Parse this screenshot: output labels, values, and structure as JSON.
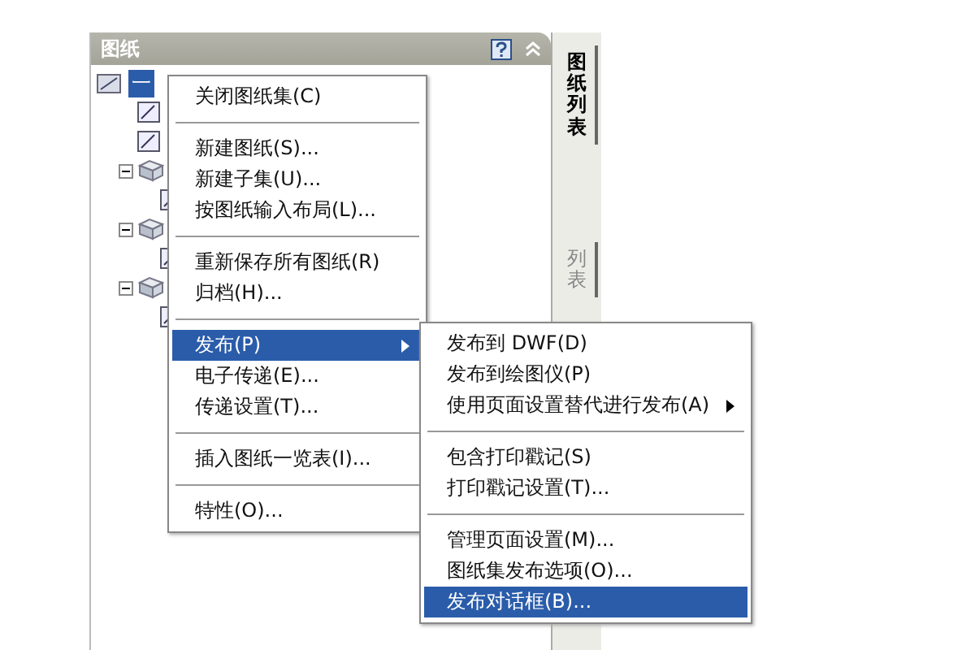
{
  "panel": {
    "title": "图纸"
  },
  "side_tabs": [
    {
      "label": "图纸列表",
      "selected": true
    },
    {
      "label": "列表",
      "selected": false
    }
  ],
  "tree": [
    {
      "kind": "set",
      "label": "一",
      "selected": true,
      "children": [
        {
          "kind": "sheet"
        },
        {
          "kind": "sheet"
        },
        {
          "kind": "subset",
          "expanded": true,
          "children": [
            {
              "kind": "sheet"
            }
          ]
        },
        {
          "kind": "subset",
          "expanded": true,
          "children": [
            {
              "kind": "sheet"
            }
          ]
        },
        {
          "kind": "subset",
          "expanded": true,
          "children": [
            {
              "kind": "sheet"
            }
          ]
        }
      ]
    }
  ],
  "context_menu": [
    {
      "kind": "item",
      "label": "关闭图纸集(C)",
      "selected": false,
      "submenu": false
    },
    {
      "kind": "separator"
    },
    {
      "kind": "item",
      "label": "新建图纸(S)...",
      "selected": false,
      "submenu": false
    },
    {
      "kind": "item",
      "label": "新建子集(U)...",
      "selected": false,
      "submenu": false
    },
    {
      "kind": "item",
      "label": "按图纸输入布局(L)...",
      "selected": false,
      "submenu": false
    },
    {
      "kind": "separator"
    },
    {
      "kind": "item",
      "label": "重新保存所有图纸(R)",
      "selected": false,
      "submenu": false
    },
    {
      "kind": "item",
      "label": "归档(H)...",
      "selected": false,
      "submenu": false
    },
    {
      "kind": "separator"
    },
    {
      "kind": "item",
      "label": "发布(P)",
      "selected": true,
      "submenu": true
    },
    {
      "kind": "item",
      "label": "电子传递(E)...",
      "selected": false,
      "submenu": false
    },
    {
      "kind": "item",
      "label": "传递设置(T)...",
      "selected": false,
      "submenu": false
    },
    {
      "kind": "separator"
    },
    {
      "kind": "item",
      "label": "插入图纸一览表(I)...",
      "selected": false,
      "submenu": false
    },
    {
      "kind": "separator"
    },
    {
      "kind": "item",
      "label": "特性(O)...",
      "selected": false,
      "submenu": false
    }
  ],
  "submenu": [
    {
      "kind": "item",
      "label": "发布到 DWF(D)",
      "selected": false,
      "submenu": false
    },
    {
      "kind": "item",
      "label": "发布到绘图仪(P)",
      "selected": false,
      "submenu": false
    },
    {
      "kind": "item",
      "label": "使用页面设置替代进行发布(A)",
      "selected": false,
      "submenu": true
    },
    {
      "kind": "separator"
    },
    {
      "kind": "item",
      "label": "包含打印戳记(S)",
      "selected": false,
      "submenu": false
    },
    {
      "kind": "item",
      "label": "打印戳记设置(T)...",
      "selected": false,
      "submenu": false
    },
    {
      "kind": "separator"
    },
    {
      "kind": "item",
      "label": "管理页面设置(M)...",
      "selected": false,
      "submenu": false
    },
    {
      "kind": "item",
      "label": "图纸集发布选项(O)...",
      "selected": false,
      "submenu": false
    },
    {
      "kind": "item",
      "label": "发布对话框(B)...",
      "selected": true,
      "submenu": false
    }
  ]
}
